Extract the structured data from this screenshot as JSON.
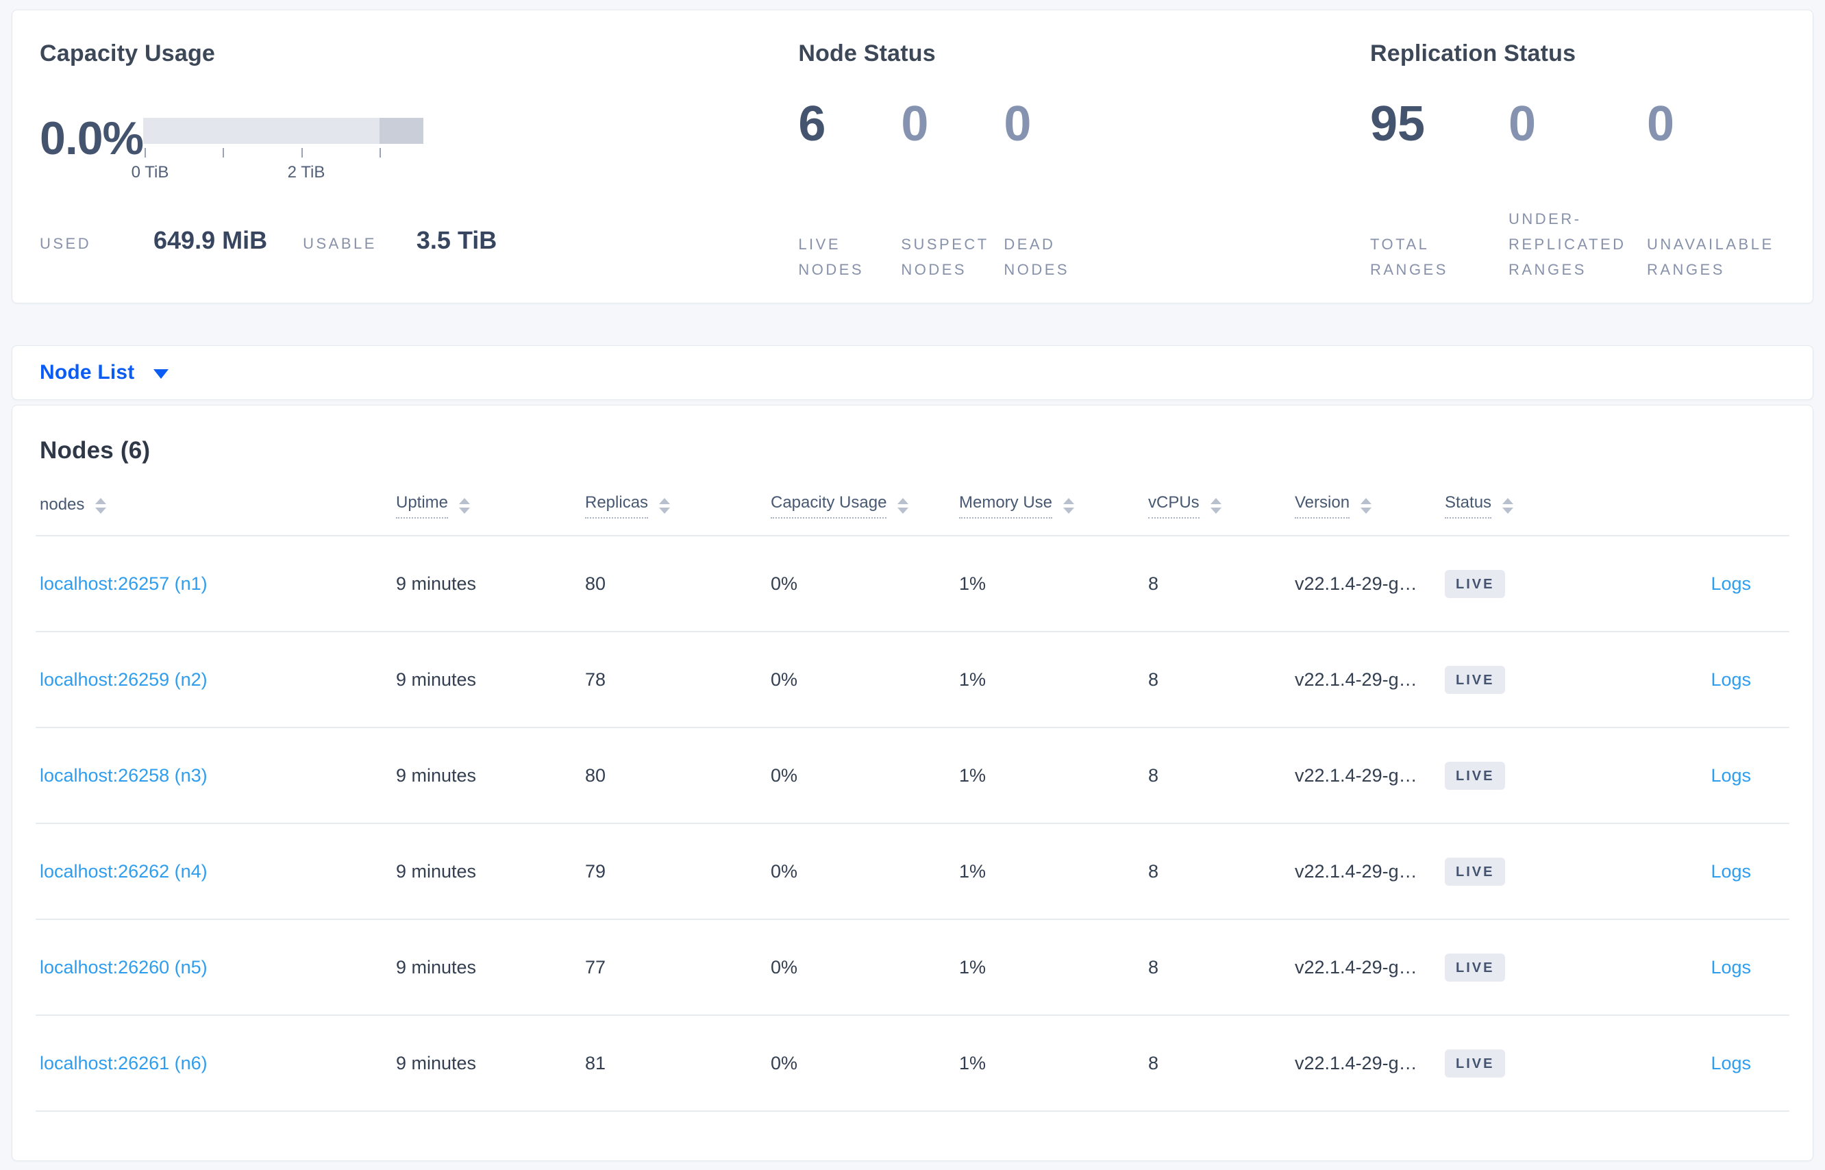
{
  "colors": {
    "accent_blue": "#0b5cf4",
    "link_blue": "#2f9ded",
    "badge_bg": "#e7eaf1",
    "dark_slate": "#44536e",
    "muted_number": "#8593b0",
    "page_background": "#f5f7fb"
  },
  "summary": {
    "capacity": {
      "title": "Capacity Usage",
      "percent": "0.0%",
      "ticks": [
        "0 TiB",
        "2 TiB"
      ],
      "used_label": "USED",
      "used_value": "649.9 MiB",
      "usable_label": "USABLE",
      "usable_value": "3.5 TiB"
    },
    "node_status": {
      "title": "Node Status",
      "stats": [
        {
          "value": "6",
          "label": "LIVE NODES"
        },
        {
          "value": "0",
          "label": "SUSPECT NODES"
        },
        {
          "value": "0",
          "label": "DEAD NODES"
        }
      ]
    },
    "replication": {
      "title": "Replication Status",
      "stats": [
        {
          "value": "95",
          "label": "TOTAL RANGES"
        },
        {
          "value": "0",
          "label": "UNDER-REPLICATED RANGES"
        },
        {
          "value": "0",
          "label": "UNAVAILABLE RANGES"
        }
      ]
    }
  },
  "view_selector": {
    "label": "Node List"
  },
  "table": {
    "title": "Nodes (6)",
    "columns": [
      {
        "label": "nodes",
        "tooltip": false
      },
      {
        "label": "Uptime",
        "tooltip": true
      },
      {
        "label": "Replicas",
        "tooltip": true
      },
      {
        "label": "Capacity Usage",
        "tooltip": true
      },
      {
        "label": "Memory Use",
        "tooltip": true
      },
      {
        "label": "vCPUs",
        "tooltip": true
      },
      {
        "label": "Version",
        "tooltip": true
      },
      {
        "label": "Status",
        "tooltip": true
      }
    ],
    "rows": [
      {
        "node": "localhost:26257 (n1)",
        "uptime": "9 minutes",
        "replicas": "80",
        "capacity": "0%",
        "memory": "1%",
        "vcpus": "8",
        "version": "v22.1.4-29-g…",
        "status": "LIVE",
        "logs": "Logs"
      },
      {
        "node": "localhost:26259 (n2)",
        "uptime": "9 minutes",
        "replicas": "78",
        "capacity": "0%",
        "memory": "1%",
        "vcpus": "8",
        "version": "v22.1.4-29-g…",
        "status": "LIVE",
        "logs": "Logs"
      },
      {
        "node": "localhost:26258 (n3)",
        "uptime": "9 minutes",
        "replicas": "80",
        "capacity": "0%",
        "memory": "1%",
        "vcpus": "8",
        "version": "v22.1.4-29-g…",
        "status": "LIVE",
        "logs": "Logs"
      },
      {
        "node": "localhost:26262 (n4)",
        "uptime": "9 minutes",
        "replicas": "79",
        "capacity": "0%",
        "memory": "1%",
        "vcpus": "8",
        "version": "v22.1.4-29-g…",
        "status": "LIVE",
        "logs": "Logs"
      },
      {
        "node": "localhost:26260 (n5)",
        "uptime": "9 minutes",
        "replicas": "77",
        "capacity": "0%",
        "memory": "1%",
        "vcpus": "8",
        "version": "v22.1.4-29-g…",
        "status": "LIVE",
        "logs": "Logs"
      },
      {
        "node": "localhost:26261 (n6)",
        "uptime": "9 minutes",
        "replicas": "81",
        "capacity": "0%",
        "memory": "1%",
        "vcpus": "8",
        "version": "v22.1.4-29-g…",
        "status": "LIVE",
        "logs": "Logs"
      }
    ]
  }
}
